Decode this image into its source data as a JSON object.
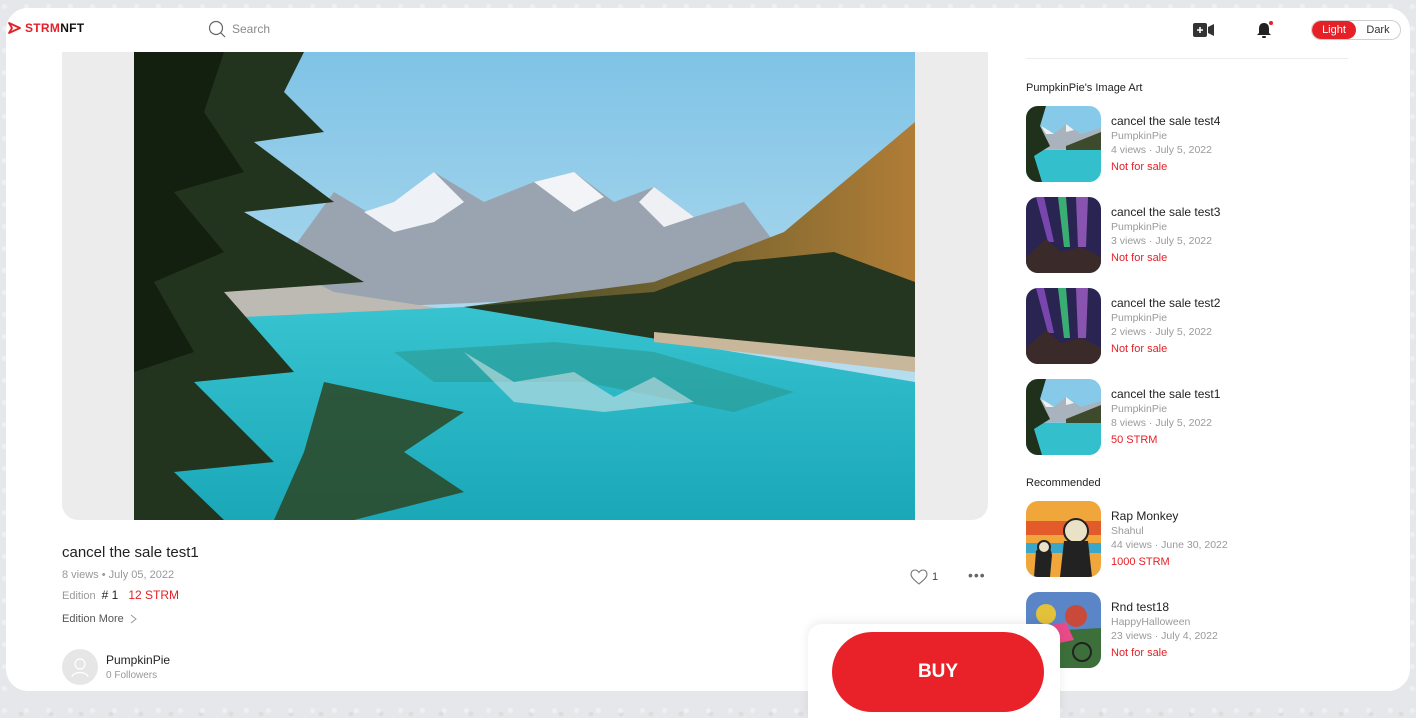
{
  "header": {
    "logo_text_red": "STRM",
    "logo_text_dark": "NFT",
    "search_placeholder": "Search",
    "theme_light": "Light",
    "theme_dark": "Dark"
  },
  "artwork": {
    "title": "cancel the sale test1",
    "meta": "8 views • July 05, 2022",
    "edition_label": "Edition",
    "edition_number": "# 1",
    "price": "12 STRM",
    "edition_more": "Edition More",
    "likes": "1",
    "owner_name": "PumpkinPie",
    "owner_followers": "0 Followers"
  },
  "sidebar": {
    "section_title": "PumpkinPie's Image Art",
    "items": [
      {
        "title": "cancel the sale test4",
        "creator": "PumpkinPie",
        "stats": "4 views · July 5, 2022",
        "status": "Not for sale",
        "thumb": "lake-thumb"
      },
      {
        "title": "cancel the sale test3",
        "creator": "PumpkinPie",
        "stats": "3 views · July 5, 2022",
        "status": "Not for sale",
        "thumb": "aurora-thumb"
      },
      {
        "title": "cancel the sale test2",
        "creator": "PumpkinPie",
        "stats": "2 views · July 5, 2022",
        "status": "Not for sale",
        "thumb": "aurora-thumb"
      },
      {
        "title": "cancel the sale test1",
        "creator": "PumpkinPie",
        "stats": "8 views · July 5, 2022",
        "status": "50 STRM",
        "thumb": "lake-thumb"
      }
    ],
    "recommended_title": "Recommended",
    "recommended": [
      {
        "title": "Rap Monkey",
        "creator": "Shahul",
        "stats": "44 views · June 30, 2022",
        "status": "1000 STRM",
        "thumb": "monkey-thumb"
      },
      {
        "title": "Rnd test18",
        "creator": "HappyHalloween",
        "stats": "23 views · July 4, 2022",
        "status": "Not for sale",
        "thumb": "cyclists-thumb"
      }
    ]
  },
  "buy_label": "BUY",
  "colors": {
    "accent": "#e52027"
  }
}
